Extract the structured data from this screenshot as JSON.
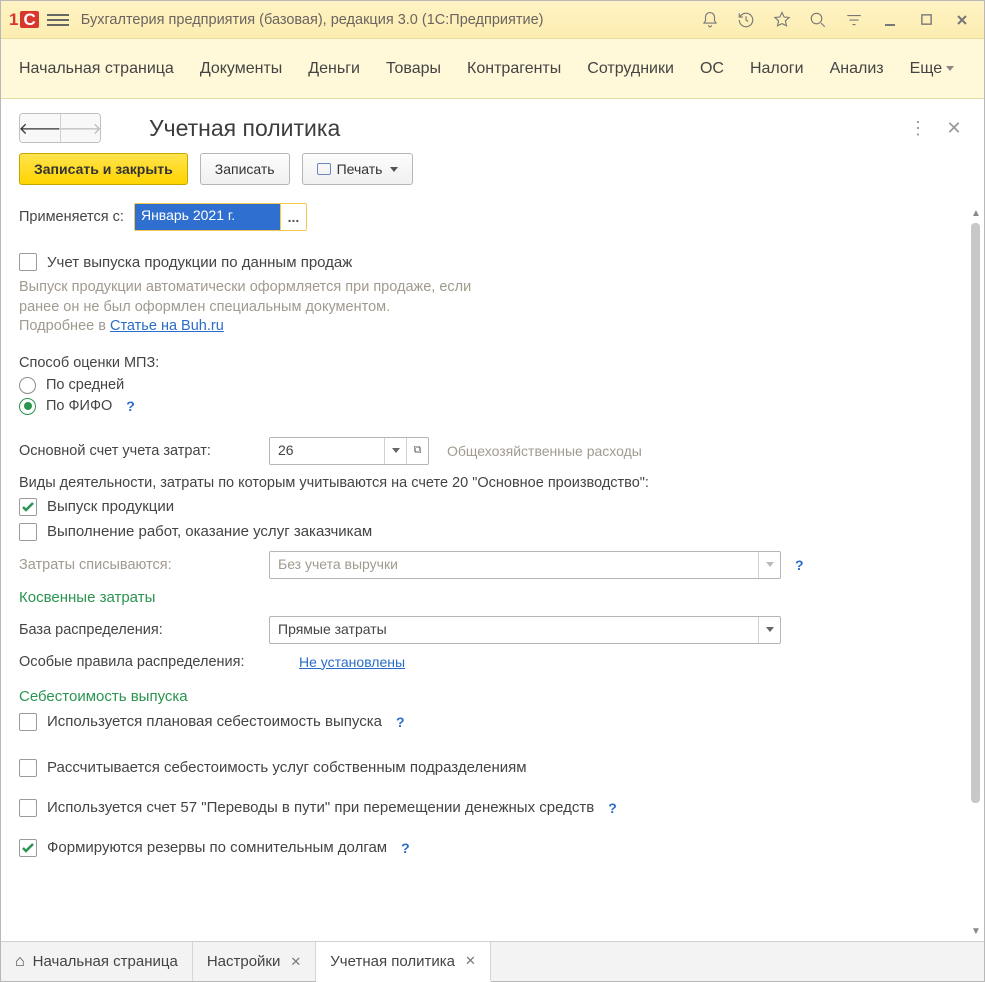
{
  "titlebar": {
    "title": "Бухгалтерия предприятия (базовая), редакция 3.0  (1С:Предприятие)"
  },
  "menu": {
    "items": [
      "Начальная страница",
      "Документы",
      "Деньги",
      "Товары",
      "Контрагенты",
      "Сотрудники",
      "ОС",
      "Налоги",
      "Анализ"
    ],
    "more": "Еще"
  },
  "page": {
    "title": "Учетная политика"
  },
  "toolbar": {
    "save_close": "Записать и закрыть",
    "save": "Записать",
    "print": "Печать"
  },
  "form": {
    "applies_from_label": "Применяется с:",
    "applies_from_value": "Январь 2021 г.",
    "chk_output_by_sales": "Учет выпуска продукции по данным продаж",
    "note_line1": "Выпуск продукции автоматически оформляется при продаже, если",
    "note_line2": "ранее он не был оформлен специальным документом.",
    "note_more": "Подробнее в ",
    "note_link": "Статье на Buh.ru",
    "mpz_label": "Способ оценки МПЗ:",
    "mpz_avg": "По средней",
    "mpz_fifo": "По ФИФО",
    "main_cost_account_label": "Основной счет учета затрат:",
    "main_cost_account_value": "26",
    "main_cost_account_hint": "Общехозяйственные расходы",
    "activity_types": "Виды деятельности, затраты по которым учитываются на счете 20 \"Основное производство\":",
    "chk_production": "Выпуск продукции",
    "chk_services": "Выполнение работ, оказание услуг заказчикам",
    "costs_writeoff_label": "Затраты списываются:",
    "costs_writeoff_value": "Без учета выручки",
    "indirect_header": "Косвенные затраты",
    "alloc_base_label": "База распределения:",
    "alloc_base_value": "Прямые затраты",
    "special_rules_label": "Особые правила распределения:",
    "special_rules_link": "Не установлены",
    "cost_output_header": "Себестоимость выпуска",
    "chk_plan_cost": "Используется плановая себестоимость выпуска",
    "chk_own_dep_cost": "Рассчитывается себестоимость услуг собственным подразделениям",
    "chk_account57": "Используется счет 57 \"Переводы в пути\" при перемещении денежных средств",
    "chk_reserves": "Формируются резервы по сомнительным долгам"
  },
  "tabs": {
    "home": "Начальная страница",
    "settings": "Настройки",
    "current": "Учетная политика"
  }
}
